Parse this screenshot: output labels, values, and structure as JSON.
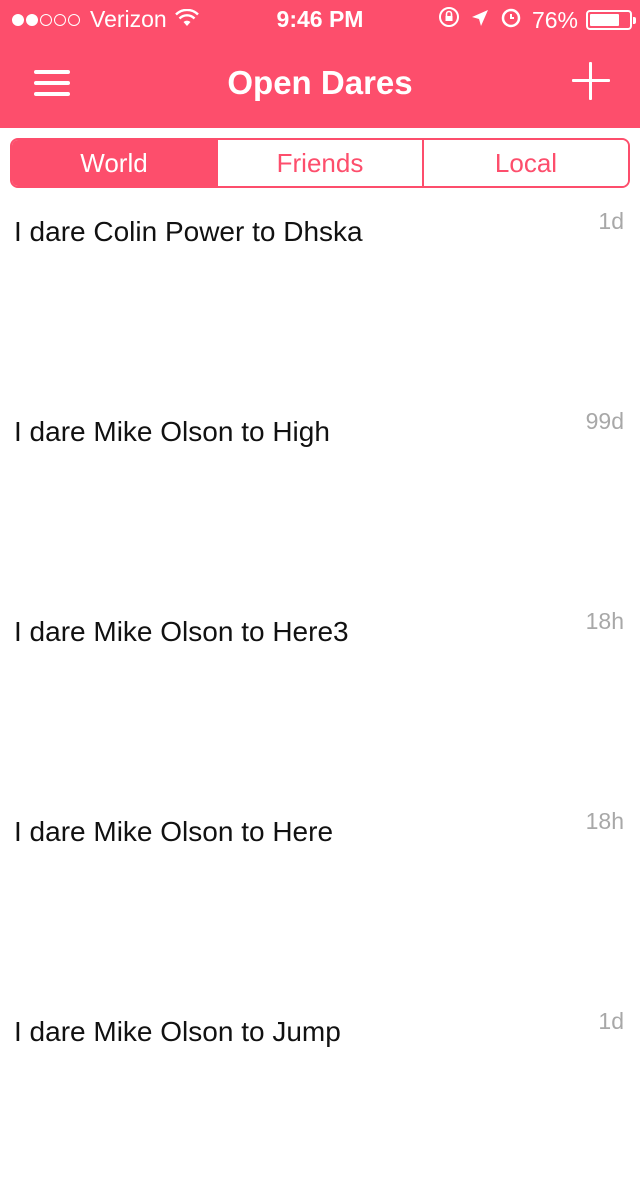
{
  "status_bar": {
    "carrier": "Verizon",
    "time": "9:46 PM",
    "battery": "76%",
    "battery_level": 0.76,
    "signal_bars": 2,
    "signal_total": 5
  },
  "header": {
    "title": "Open Dares",
    "background_color": "#fd4e6c"
  },
  "tabs": [
    {
      "label": "World",
      "active": true
    },
    {
      "label": "Friends",
      "active": false
    },
    {
      "label": "Local",
      "active": false
    }
  ],
  "dares": [
    {
      "text": "I dare Colin Power to Dhska",
      "age": "1d"
    },
    {
      "text": "I dare Mike Olson to High",
      "age": "99d"
    },
    {
      "text": "I dare Mike Olson to Here3",
      "age": "18h"
    },
    {
      "text": "I dare Mike Olson to Here",
      "age": "18h"
    },
    {
      "text": "I dare Mike Olson to Jump",
      "age": "1d"
    }
  ]
}
